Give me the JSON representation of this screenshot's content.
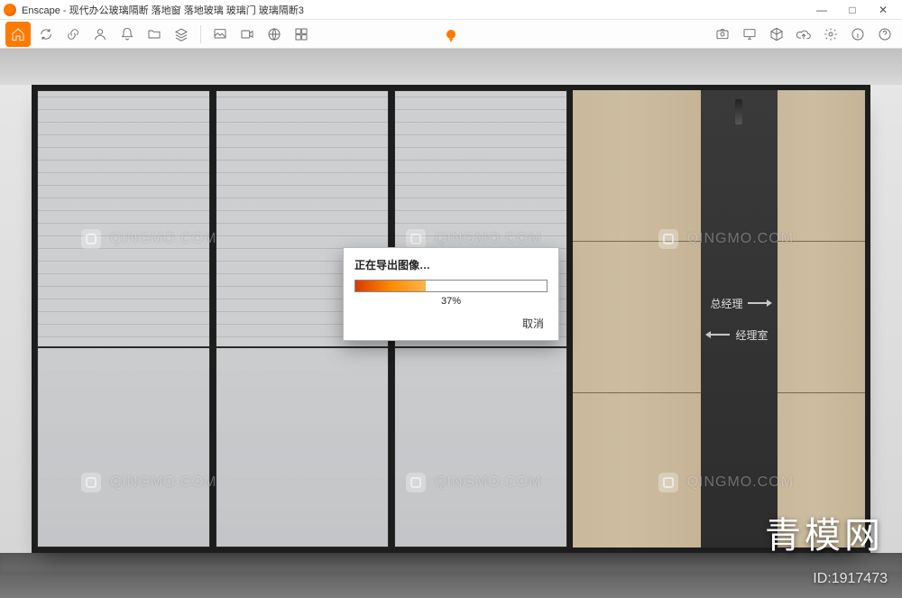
{
  "window": {
    "app_name": "Enscape",
    "title": "Enscape - 现代办公玻璃隔断 落地窗 落地玻璃 玻璃门 玻璃隔断3",
    "minimize_glyph": "—",
    "maximize_glyph": "□",
    "close_glyph": "✕"
  },
  "toolbar": {
    "left_icons": [
      "home",
      "sync",
      "link",
      "user",
      "bell",
      "folder",
      "layers"
    ],
    "left_icons2": [
      "image-export",
      "video-export",
      "pano-export",
      "batch-export"
    ],
    "right_icons": [
      "screenshot",
      "monitor",
      "cube",
      "cloud-upload",
      "settings",
      "info",
      "help"
    ]
  },
  "dialog": {
    "title": "正在导出图像…",
    "percent": 37,
    "percent_label": "37%",
    "cancel_label": "取消"
  },
  "signage": {
    "line1": "总经理",
    "line2": "经理室"
  },
  "watermark": {
    "text": "QINGMO.COM",
    "brand": "青模网",
    "id_prefix": "ID:",
    "id_value": "1917473"
  }
}
